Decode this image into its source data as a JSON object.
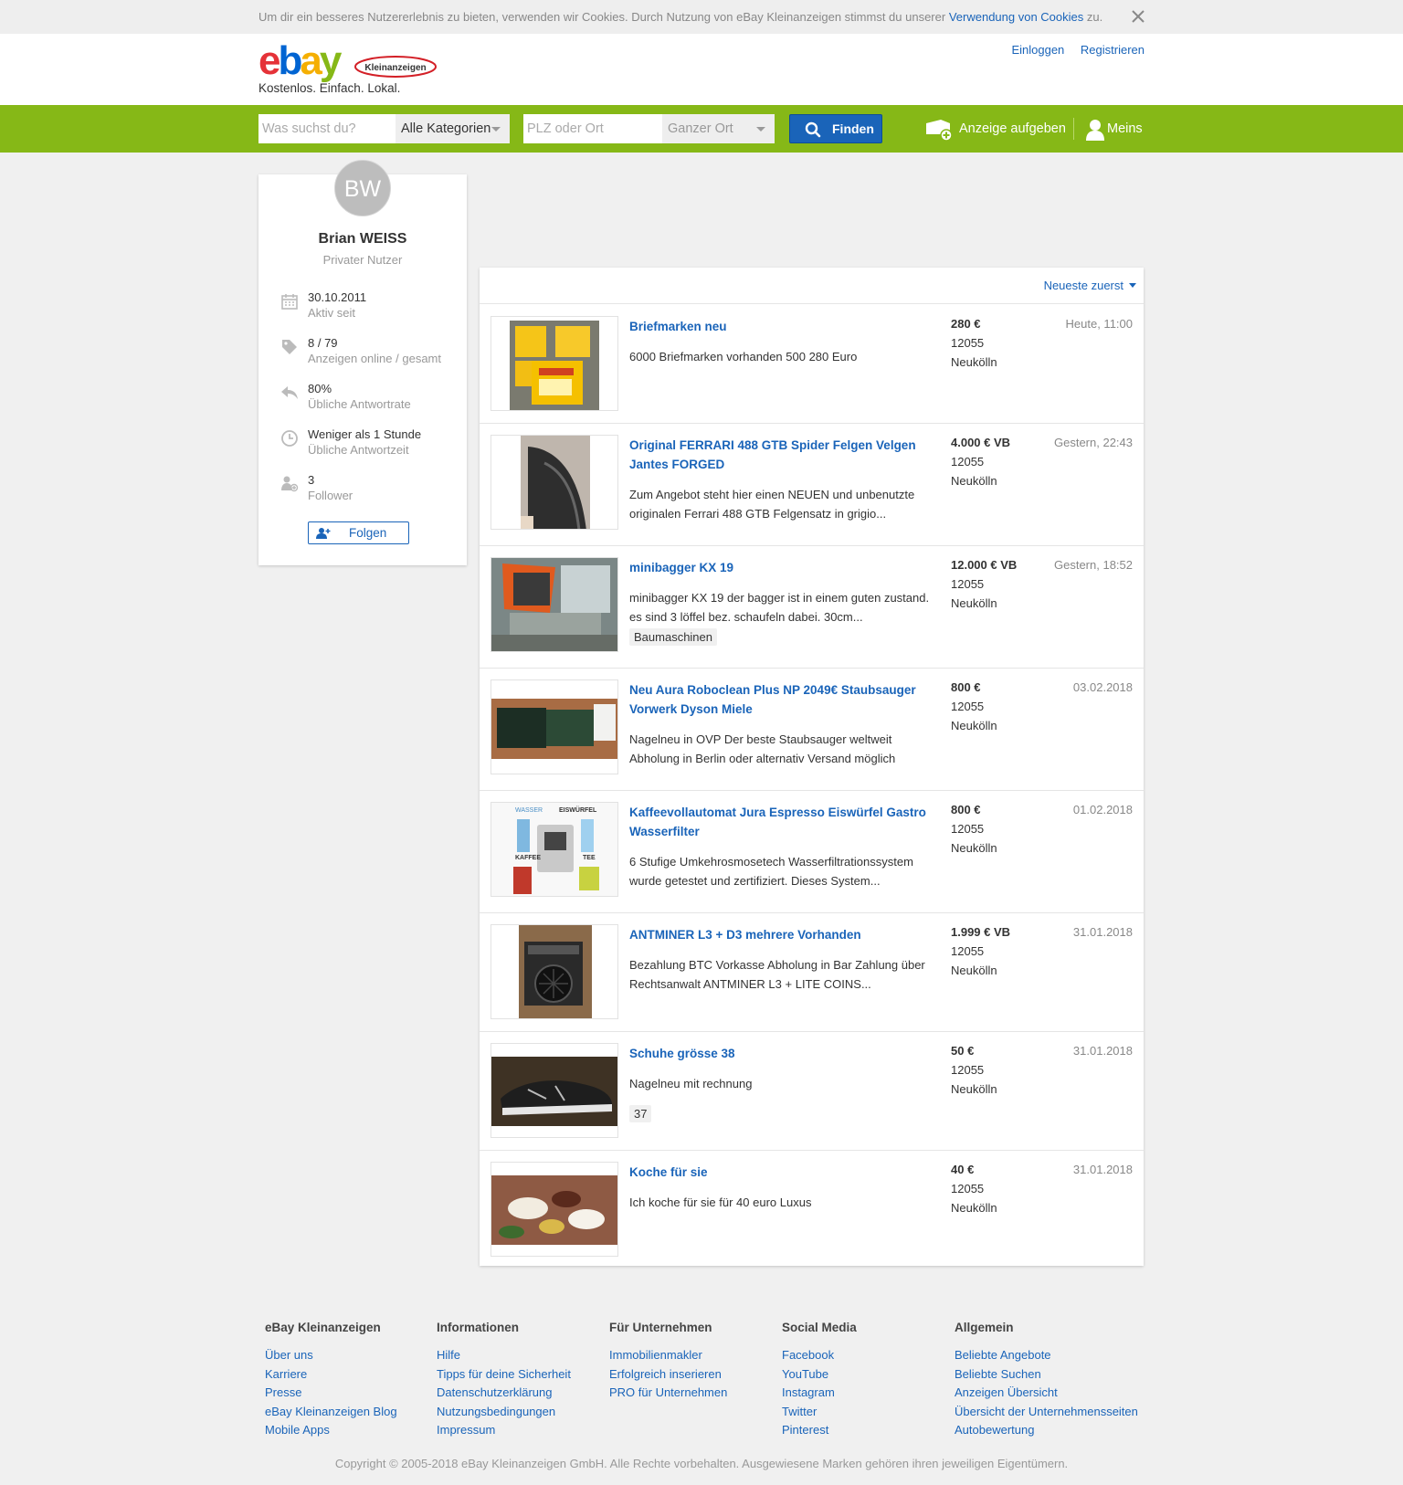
{
  "cookie": {
    "text": "Um dir ein besseres Nutzererlebnis zu bieten, verwenden wir Cookies. Durch Nutzung von eBay Kleinanzeigen stimmst du unserer",
    "link": "Verwendung von Cookies",
    "suffix": "zu."
  },
  "header": {
    "logo_text": "ebay",
    "logo_badge": "Kleinanzeigen",
    "tagline": "Kostenlos. Einfach. Lokal.",
    "login": "Einloggen",
    "register": "Registrieren"
  },
  "search": {
    "query_placeholder": "Was suchst du?",
    "category": "Alle Kategorien",
    "location_placeholder": "PLZ oder Ort",
    "radius": "Ganzer Ort",
    "find_label": "Finden",
    "post_ad": "Anzeige aufgeben",
    "meins": "Meins"
  },
  "profile": {
    "initials": "BW",
    "name": "Brian WEISS",
    "type": "Privater Nutzer",
    "stats": [
      {
        "value": "30.10.2011",
        "label": "Aktiv seit",
        "icon": "calendar-icon"
      },
      {
        "value": "8 / 79",
        "label": "Anzeigen online / gesamt",
        "icon": "tag-icon"
      },
      {
        "value": "80%",
        "label": "Übliche Antwortrate",
        "icon": "reply-icon"
      },
      {
        "value": "Weniger als 1 Stunde",
        "label": "Übliche Antwortzeit",
        "icon": "clock-icon"
      },
      {
        "value": "3",
        "label": "Follower",
        "icon": "followers-icon"
      }
    ],
    "follow_label": "Folgen"
  },
  "listing": {
    "sort_label": "Neueste zuerst",
    "items": [
      {
        "title": "Briefmarken neu",
        "desc": "6000 Briefmarken vorhanden 500 280 Euro",
        "price": "280 €",
        "zip": "12055",
        "city": "Neukölln",
        "date": "Heute, 11:00",
        "tag": ""
      },
      {
        "title": "Original FERRARI 488 GTB Spider Felgen Velgen Jantes FORGED",
        "desc": "Zum Angebot steht hier einen NEUEN und unbenutzte originalen Ferrari 488 GTB Felgensatz in grigio...",
        "price": "4.000 € VB",
        "zip": "12055",
        "city": "Neukölln",
        "date": "Gestern, 22:43",
        "tag": ""
      },
      {
        "title": "minibagger KX 19",
        "desc": "minibagger KX 19 der bagger ist in einem guten zustand. es sind 3 löffel bez. schaufeln dabei. 30cm...",
        "price": "12.000 € VB",
        "zip": "12055",
        "city": "Neukölln",
        "date": "Gestern, 18:52",
        "tag": "Baumaschinen"
      },
      {
        "title": "Neu Aura Roboclean Plus NP 2049€ Staubsauger Vorwerk Dyson Miele",
        "desc": "Nagelneu in OVP Der beste Staubsauger weltweit Abholung in Berlin oder alternativ Versand möglich",
        "price": "800 €",
        "zip": "12055",
        "city": "Neukölln",
        "date": "03.02.2018",
        "tag": ""
      },
      {
        "title": "Kaffeevollautomat Jura Espresso Eiswürfel Gastro Wasserfilter",
        "desc": "6 Stufige Umkehrosmosetech Wasserfiltrationssystem wurde getestet und zertifiziert. Dieses System...",
        "price": "800 €",
        "zip": "12055",
        "city": "Neukölln",
        "date": "01.02.2018",
        "tag": "",
        "thumb_labels": [
          "WASSER",
          "EISWÜRFEL",
          "KAFFEE",
          "TEE"
        ]
      },
      {
        "title": "ANTMINER L3 + D3 mehrere Vorhanden",
        "desc": "Bezahlung BTC Vorkasse Abholung in Bar Zahlung über Rechtsanwalt ANTMINER L3 + LITE COINS...",
        "price": "1.999 € VB",
        "zip": "12055",
        "city": "Neukölln",
        "date": "31.01.2018",
        "tag": ""
      },
      {
        "title": "Schuhe grösse 38",
        "desc": "Nagelneu mit rechnung",
        "price": "50 €",
        "zip": "12055",
        "city": "Neukölln",
        "date": "31.01.2018",
        "tag": "37"
      },
      {
        "title": "Koche für sie",
        "desc": "Ich koche für sie für 40 euro Luxus",
        "price": "40 €",
        "zip": "12055",
        "city": "Neukölln",
        "date": "31.01.2018",
        "tag": ""
      }
    ]
  },
  "footer": {
    "columns": [
      {
        "title": "eBay Kleinanzeigen",
        "links": [
          "Über uns",
          "Karriere",
          "Presse",
          "eBay Kleinanzeigen Blog",
          "Mobile Apps"
        ]
      },
      {
        "title": "Informationen",
        "links": [
          "Hilfe",
          "Tipps für deine Sicherheit",
          "Datenschutzerklärung",
          "Nutzungsbedingungen",
          "Impressum"
        ]
      },
      {
        "title": "Für Unternehmen",
        "links": [
          "Immobilienmakler",
          "Erfolgreich inserieren",
          "PRO für Unternehmen"
        ]
      },
      {
        "title": "Social Media",
        "links": [
          "Facebook",
          "YouTube",
          "Instagram",
          "Twitter",
          "Pinterest"
        ]
      },
      {
        "title": "Allgemein",
        "links": [
          "Beliebte Angebote",
          "Beliebte Suchen",
          "Anzeigen Übersicht",
          "Übersicht der Unternehmensseiten",
          "Autobewertung"
        ]
      }
    ],
    "copyright": "Copyright © 2005-2018 eBay Kleinanzeigen GmbH. Alle Rechte vorbehalten. Ausgewiesene Marken gehören ihren jeweiligen Eigentümern."
  },
  "colors": {
    "green": "#86b817",
    "blue": "#1a64b9"
  }
}
